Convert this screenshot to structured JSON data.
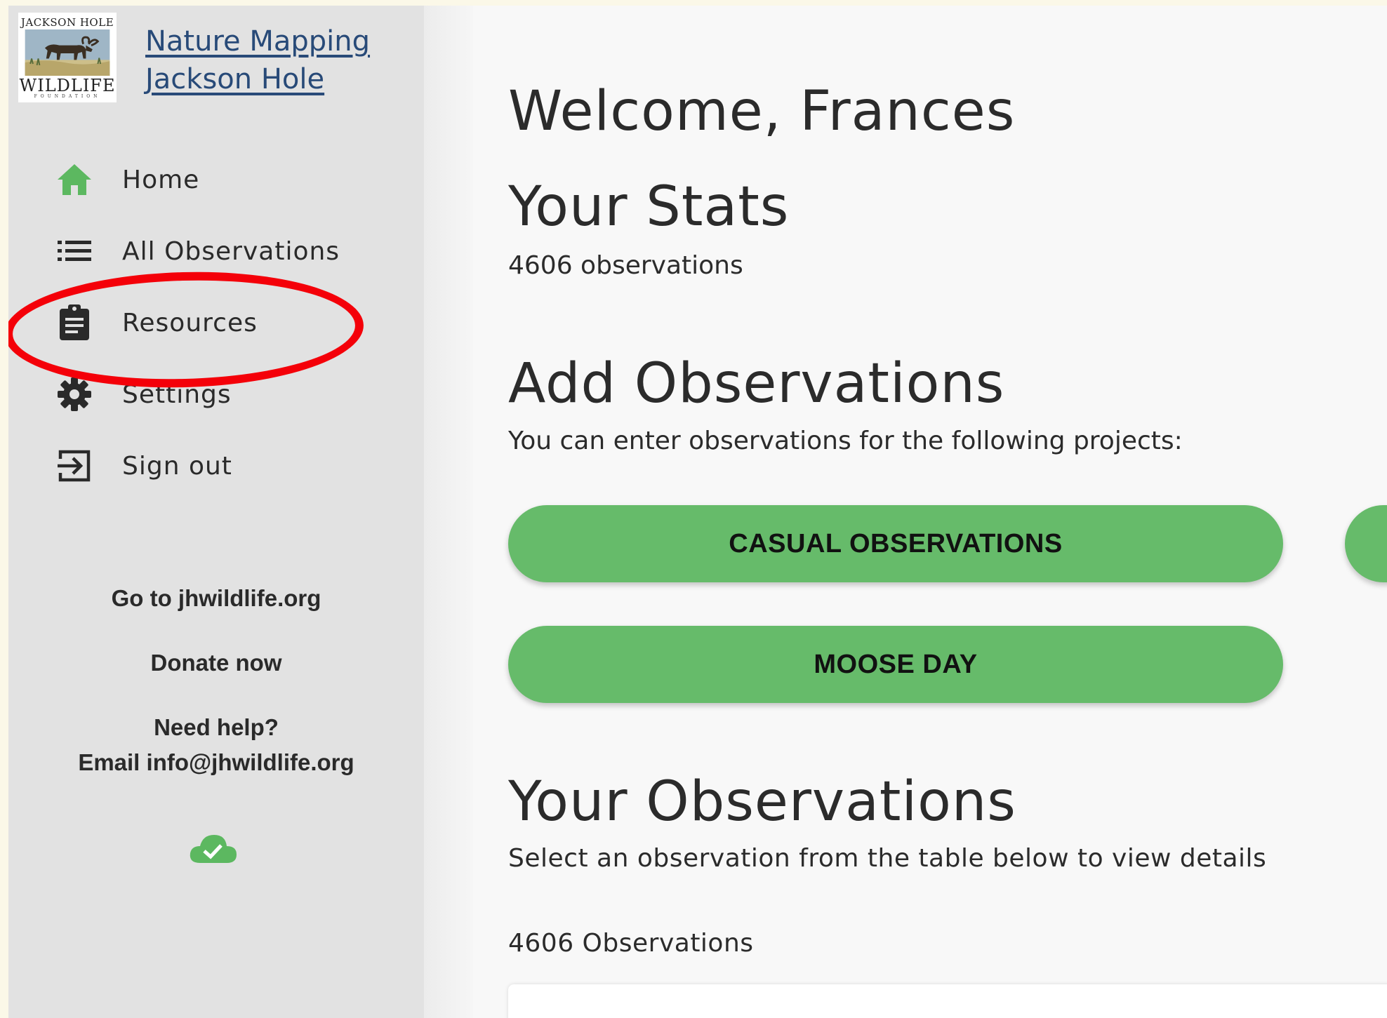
{
  "brand": {
    "logo_top": "JACKSON HOLE",
    "logo_wildlife": "WILDLIFE",
    "logo_foundation": "FOUNDATION",
    "title_line1": "Nature Mapping",
    "title_line2": "Jackson Hole"
  },
  "nav": {
    "items": [
      {
        "label": "Home",
        "icon": "home-icon"
      },
      {
        "label": "All Observations",
        "icon": "list-icon"
      },
      {
        "label": "Resources",
        "icon": "clipboard-icon"
      },
      {
        "label": "Settings",
        "icon": "gear-icon"
      },
      {
        "label": "Sign out",
        "icon": "sign-out-icon"
      }
    ]
  },
  "sidebar_links": {
    "website": "Go to jhwildlife.org",
    "donate": "Donate now",
    "help_line1": "Need help?",
    "help_line2": "Email info@jhwildlife.org"
  },
  "sync_status": {
    "icon": "cloud-check-icon",
    "color": "#5cb860"
  },
  "main": {
    "welcome": "Welcome, Frances",
    "stats_heading": "Your Stats",
    "stats_count": "4606 observations",
    "add_heading": "Add Observations",
    "add_subtitle": "You can enter observations for the following projects:",
    "projects": [
      "CASUAL OBSERVATIONS",
      "MOOSE DAY"
    ],
    "your_obs_heading": "Your Observations",
    "your_obs_subtitle": "Select an observation from the table below to view details",
    "obs_count": "4606 Observations"
  },
  "colors": {
    "accent_green": "#66bb6a",
    "annotation_red": "#f40009",
    "link_blue": "#284a78",
    "sidebar_bg": "#e2e2e2"
  }
}
